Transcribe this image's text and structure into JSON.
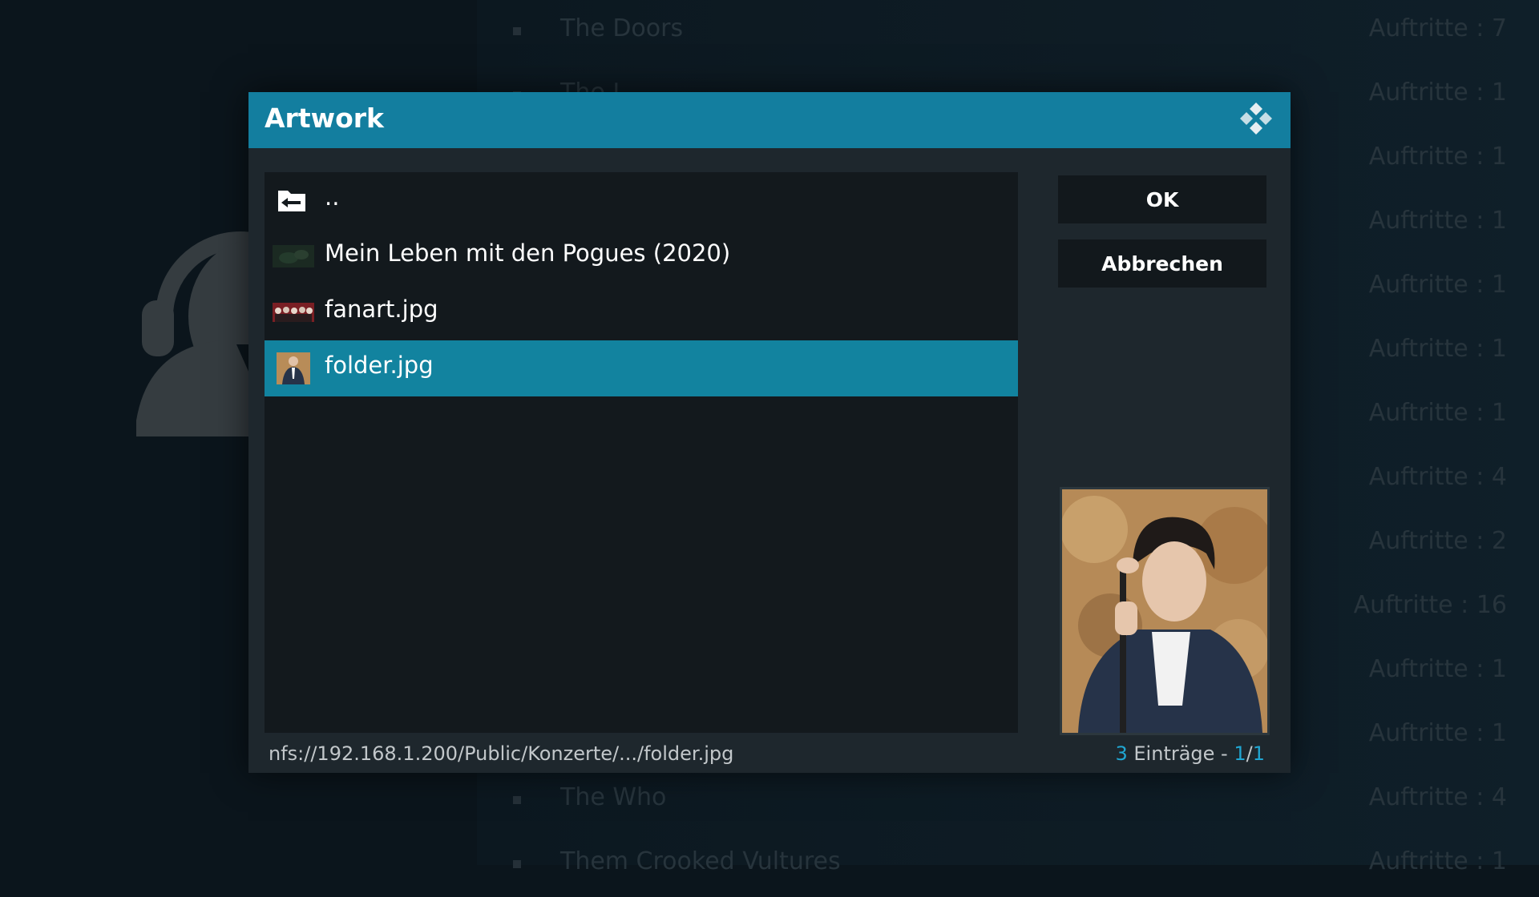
{
  "background": {
    "rows": [
      {
        "name": "The Doors",
        "count": "Auftritte : 7"
      },
      {
        "name": "The J",
        "count": "Auftritte : 1"
      },
      {
        "name": "",
        "count": "Auftritte : 1"
      },
      {
        "name": "",
        "count": "Auftritte : 1"
      },
      {
        "name": "",
        "count": "Auftritte : 1"
      },
      {
        "name": "",
        "count": "Auftritte : 1"
      },
      {
        "name": "",
        "count": "Auftritte : 1"
      },
      {
        "name": "",
        "count": "Auftritte : 4"
      },
      {
        "name": "",
        "count": "Auftritte : 2"
      },
      {
        "name": "",
        "count": "Auftritte : 16"
      },
      {
        "name": "",
        "count": "Auftritte : 1"
      },
      {
        "name": "",
        "count": "Auftritte : 1"
      },
      {
        "name": "The Who",
        "count": "Auftritte : 4"
      },
      {
        "name": "Them Crooked Vultures",
        "count": "Auftritte : 1"
      }
    ]
  },
  "dialog": {
    "title": "Artwork",
    "items": [
      {
        "label": "..",
        "icon": "folder-back-icon",
        "selected": false
      },
      {
        "label": "Mein Leben mit den Pogues (2020)",
        "icon": "video-thumbnail",
        "selected": false
      },
      {
        "label": "fanart.jpg",
        "icon": "fanart-thumbnail",
        "selected": false
      },
      {
        "label": "folder.jpg",
        "icon": "folder-thumbnail",
        "selected": true
      }
    ],
    "buttons": {
      "ok": "OK",
      "cancel": "Abbrechen"
    },
    "status": {
      "path": "nfs://192.168.1.200/Public/Konzerte/.../folder.jpg",
      "count": "3",
      "entries_label": " Einträge - ",
      "page": "1",
      "page_sep": "/",
      "pages": "1"
    }
  },
  "colors": {
    "accent": "#137e9f",
    "selected": "#12839f",
    "highlight": "#20a6d2"
  }
}
